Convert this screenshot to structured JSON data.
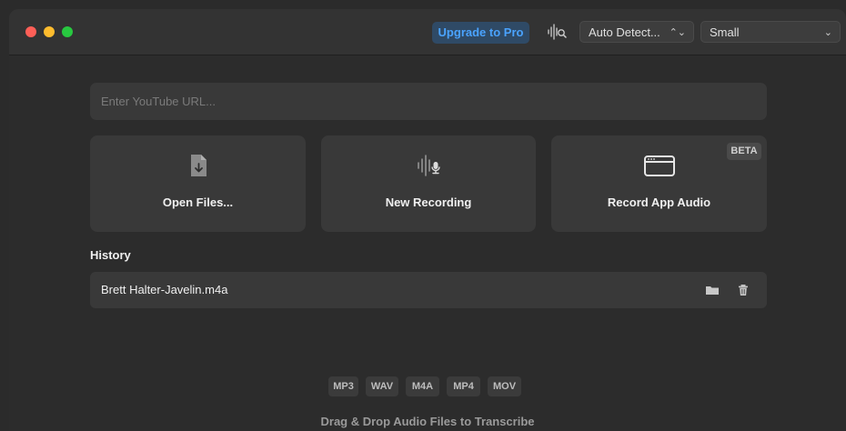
{
  "toolbar": {
    "upgrade_label": "Upgrade to Pro",
    "language_value": "Auto Detect...",
    "model_value": "Small",
    "accent_color": "#4aa3ff"
  },
  "search": {
    "placeholder": "Enter YouTube URL..."
  },
  "actions": {
    "open_files": {
      "label": "Open Files...",
      "icon": "download-document-icon"
    },
    "new_recording": {
      "label": "New Recording",
      "icon": "waveform-mic-icon"
    },
    "record_app_audio": {
      "label": "Record App Audio",
      "icon": "app-window-icon",
      "badge": "BETA"
    }
  },
  "history": {
    "title": "History",
    "items": [
      {
        "name": "Brett Halter-Javelin.m4a"
      }
    ]
  },
  "formats": [
    "MP3",
    "WAV",
    "M4A",
    "MP4",
    "MOV"
  ],
  "drop_hint": "Drag & Drop Audio Files to Transcribe"
}
